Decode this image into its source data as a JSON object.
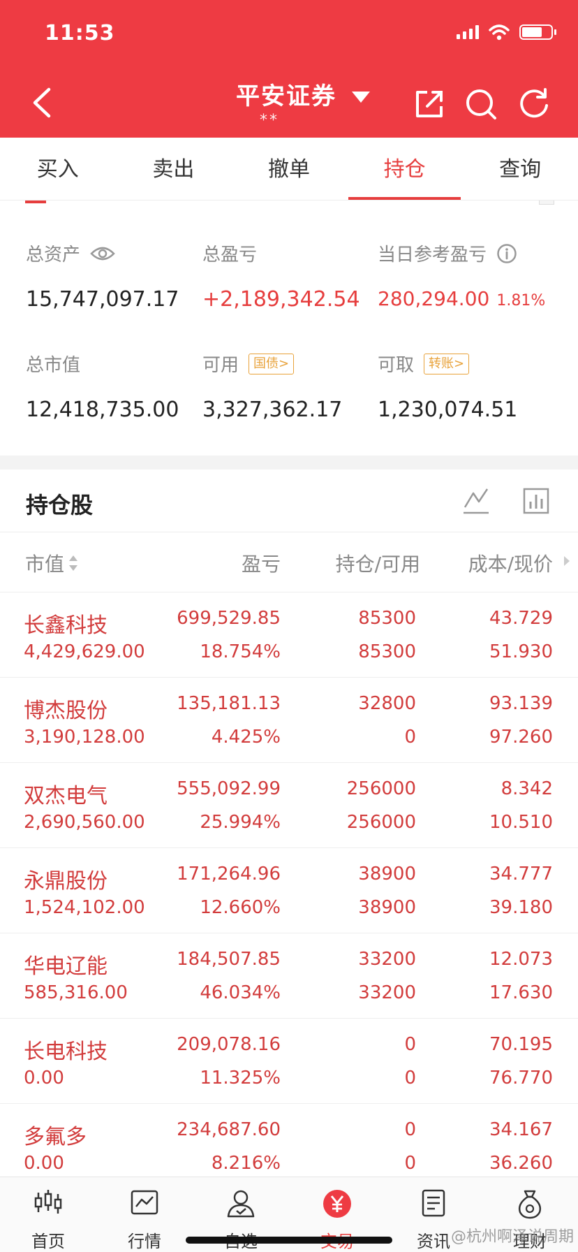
{
  "status_bar": {
    "time": "11:53"
  },
  "header": {
    "title": "平安证券",
    "account_masked": "**"
  },
  "tabs": [
    {
      "label": "买入"
    },
    {
      "label": "卖出"
    },
    {
      "label": "撤单"
    },
    {
      "label": "持仓",
      "active": true
    },
    {
      "label": "查询"
    }
  ],
  "summary": {
    "total_assets": {
      "label": "总资产",
      "value": "15,747,097.17"
    },
    "total_pnl": {
      "label": "总盈亏",
      "value": "+2,189,342.54"
    },
    "daily_pnl": {
      "label": "当日参考盈亏",
      "value": "280,294.00",
      "pct": "1.81%"
    },
    "market_value": {
      "label": "总市值",
      "value": "12,418,735.00"
    },
    "available": {
      "label": "可用",
      "tag": "国债>",
      "value": "3,327,362.17"
    },
    "withdrawable": {
      "label": "可取",
      "tag": "转账>",
      "value": "1,230,074.51"
    }
  },
  "holdings": {
    "title": "持仓股",
    "columns": {
      "market_value": "市值",
      "pnl": "盈亏",
      "position": "持仓/可用",
      "cost_price": "成本/现价"
    },
    "rows": [
      {
        "name": "长鑫科技",
        "market_value": "4,429,629.00",
        "pnl": "699,529.85",
        "pnl_pct": "18.754%",
        "position": "85300",
        "available": "85300",
        "cost": "43.729",
        "price": "51.930"
      },
      {
        "name": "博杰股份",
        "market_value": "3,190,128.00",
        "pnl": "135,181.13",
        "pnl_pct": "4.425%",
        "position": "32800",
        "available": "0",
        "cost": "93.139",
        "price": "97.260"
      },
      {
        "name": "双杰电气",
        "market_value": "2,690,560.00",
        "pnl": "555,092.99",
        "pnl_pct": "25.994%",
        "position": "256000",
        "available": "256000",
        "cost": "8.342",
        "price": "10.510"
      },
      {
        "name": "永鼎股份",
        "market_value": "1,524,102.00",
        "pnl": "171,264.96",
        "pnl_pct": "12.660%",
        "position": "38900",
        "available": "38900",
        "cost": "34.777",
        "price": "39.180"
      },
      {
        "name": "华电辽能",
        "market_value": "585,316.00",
        "pnl": "184,507.85",
        "pnl_pct": "46.034%",
        "position": "33200",
        "available": "33200",
        "cost": "12.073",
        "price": "17.630"
      },
      {
        "name": "长电科技",
        "market_value": "0.00",
        "pnl": "209,078.16",
        "pnl_pct": "11.325%",
        "position": "0",
        "available": "0",
        "cost": "70.195",
        "price": "76.770"
      },
      {
        "name": "多氟多",
        "market_value": "0.00",
        "pnl": "234,687.60",
        "pnl_pct": "8.216%",
        "position": "0",
        "available": "0",
        "cost": "34.167",
        "price": "36.260"
      }
    ]
  },
  "bottom_nav": [
    {
      "label": "首页",
      "icon": "candlestick-icon"
    },
    {
      "label": "行情",
      "icon": "line-chart-icon"
    },
    {
      "label": "自选",
      "icon": "user-icon"
    },
    {
      "label": "交易",
      "icon": "yuan-icon",
      "active": true
    },
    {
      "label": "资讯",
      "icon": "document-icon"
    },
    {
      "label": "理财",
      "icon": "moneybag-icon"
    }
  ],
  "watermark": "@杭州啊泽说周期",
  "colors": {
    "brand_red": "#ee3b43",
    "text_red": "#d23c3c",
    "tag_orange": "#e8a23a"
  }
}
